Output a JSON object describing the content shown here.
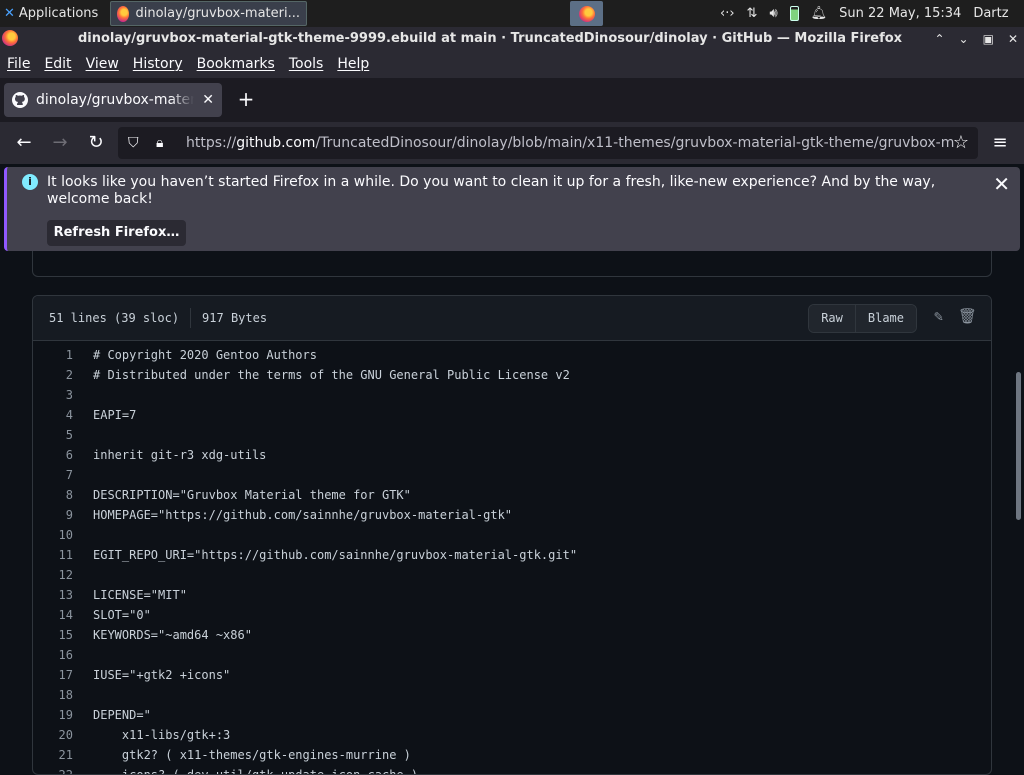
{
  "panel": {
    "apps_label": "Applications",
    "task_label": "dinolay/gruvbox-materi...",
    "clock": "Sun 22 May, 15:34",
    "user": "Dartz"
  },
  "window": {
    "title": "dinolay/gruvbox-material-gtk-theme-9999.ebuild at main · TruncatedDinosour/dinolay · GitHub — Mozilla Firefox"
  },
  "menu": [
    "File",
    "Edit",
    "View",
    "History",
    "Bookmarks",
    "Tools",
    "Help"
  ],
  "tab": {
    "label": "dinolay/gruvbox-material-gtk-theme"
  },
  "url": {
    "prefix": "https://",
    "host": "github.com",
    "path": "/TruncatedDinosour/dinolay/blob/main/x11-themes/gruvbox-material-gtk-theme/gruvbox-m"
  },
  "notification": {
    "message": "It looks like you haven’t started Firefox in a while. Do you want to clean it up for a fresh, like-new experience? And by the way, welcome back!",
    "button": "Refresh Firefox…"
  },
  "file": {
    "lines_info": "51 lines (39 sloc)",
    "size": "917 Bytes",
    "raw_label": "Raw",
    "blame_label": "Blame",
    "code": [
      "# Copyright 2020 Gentoo Authors",
      "# Distributed under the terms of the GNU General Public License v2",
      "",
      "EAPI=7",
      "",
      "inherit git-r3 xdg-utils",
      "",
      "DESCRIPTION=\"Gruvbox Material theme for GTK\"",
      "HOMEPAGE=\"https://github.com/sainnhe/gruvbox-material-gtk\"",
      "",
      "EGIT_REPO_URI=\"https://github.com/sainnhe/gruvbox-material-gtk.git\"",
      "",
      "LICENSE=\"MIT\"",
      "SLOT=\"0\"",
      "KEYWORDS=\"~amd64 ~x86\"",
      "",
      "IUSE=\"+gtk2 +icons\"",
      "",
      "DEPEND=\"",
      "    x11-libs/gtk+:3",
      "    gtk2? ( x11-themes/gtk-engines-murrine )",
      "    icons? ( dev-util/gtk-update-icon-cache )"
    ]
  }
}
